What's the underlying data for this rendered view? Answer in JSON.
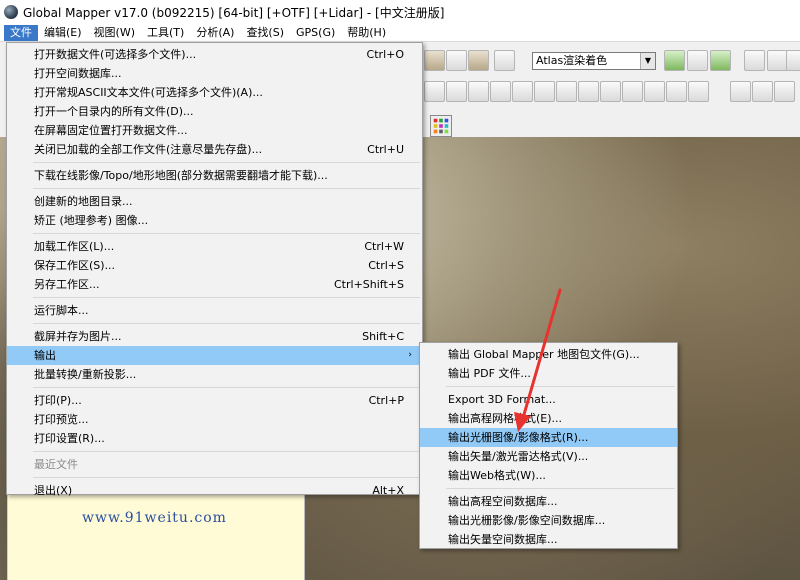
{
  "window": {
    "title": "Global Mapper v17.0 (b092215) [64-bit] [+OTF] [+Lidar] - [中文注册版]",
    "icon": "globe-icon"
  },
  "menubar": [
    {
      "label": "文件",
      "active": true
    },
    {
      "label": "编辑(E)"
    },
    {
      "label": "视图(W)"
    },
    {
      "label": "工具(T)"
    },
    {
      "label": "分析(A)"
    },
    {
      "label": "查找(S)"
    },
    {
      "label": "GPS(G)"
    },
    {
      "label": "帮助(H)"
    }
  ],
  "toolbar": {
    "shader_value": "Atlas渲染着色"
  },
  "file_menu": {
    "items": [
      {
        "label": "打开数据文件(可选择多个文件)...",
        "shortcut": "Ctrl+O"
      },
      {
        "label": "打开空间数据库..."
      },
      {
        "label": "打开常规ASCII文本文件(可选择多个文件)(A)..."
      },
      {
        "label": "打开一个目录内的所有文件(D)..."
      },
      {
        "label": "在屏幕固定位置打开数据文件..."
      },
      {
        "label": "关闭已加载的全部工作文件(注意尽量先存盘)...",
        "shortcut": "Ctrl+U"
      },
      {
        "label": "下载在线影像/Topo/地形地图(部分数据需要翻墙才能下载)..."
      },
      {
        "label": "创建新的地图目录..."
      },
      {
        "label": "矫正 (地理参考) 图像..."
      },
      {
        "label": "加载工作区(L)...",
        "shortcut": "Ctrl+W"
      },
      {
        "label": "保存工作区(S)...",
        "shortcut": "Ctrl+S"
      },
      {
        "label": "另存工作区...",
        "shortcut": "Ctrl+Shift+S"
      },
      {
        "label": "运行脚本..."
      },
      {
        "label": "截屏并存为图片...",
        "shortcut": "Shift+C"
      },
      {
        "label": "输出",
        "submenu_arrow": "›"
      },
      {
        "label": "批量转换/重新投影..."
      },
      {
        "label": "打印(P)...",
        "shortcut": "Ctrl+P"
      },
      {
        "label": "打印预览..."
      },
      {
        "label": "打印设置(R)..."
      },
      {
        "label": "最近文件"
      },
      {
        "label": "退出(X)",
        "shortcut": "Alt+X"
      }
    ]
  },
  "export_submenu": {
    "items": [
      {
        "label": "输出 Global Mapper 地图包文件(G)..."
      },
      {
        "label": "输出 PDF 文件..."
      },
      {
        "label": "Export 3D Format..."
      },
      {
        "label": "输出高程网格格式(E)..."
      },
      {
        "label": "输出光栅图像/影像格式(R)..."
      },
      {
        "label": "输出矢量/激光雷达格式(V)..."
      },
      {
        "label": "输出Web格式(W)..."
      },
      {
        "label": "输出高程空间数据库..."
      },
      {
        "label": "输出光栅影像/影像空间数据库..."
      },
      {
        "label": "输出矢量空间数据库..."
      }
    ]
  },
  "watermark": "www.91weitu.com",
  "colors": {
    "menu_highlight": "#91c9f7",
    "menubar_active": "#3a79c9",
    "panel_bg": "#fffbd6",
    "arrow": "#e8322f"
  }
}
